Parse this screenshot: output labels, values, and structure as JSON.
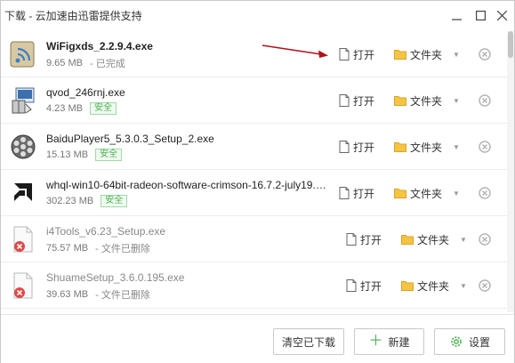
{
  "window": {
    "title": "下载 - 云加速由迅雷提供支持"
  },
  "actions": {
    "open_label": "打开",
    "folder_label": "文件夹"
  },
  "downloads": [
    {
      "name": "WiFigxds_2.2.9.4.exe",
      "size": "9.65 MB",
      "status": "- 已完成",
      "badge": "",
      "icon": "wifi-app-icon"
    },
    {
      "name": "qvod_246rnj.exe",
      "size": "4.23 MB",
      "status": "",
      "badge": "安全",
      "icon": "installer-icon"
    },
    {
      "name": "BaiduPlayer5_5.3.0.3_Setup_2.exe",
      "size": "15.13 MB",
      "status": "",
      "badge": "安全",
      "icon": "film-reel-icon"
    },
    {
      "name": "whql-win10-64bit-radeon-software-crimson-16.7.2-july19.e...",
      "size": "302.23 MB",
      "status": "",
      "badge": "安全",
      "icon": "amd-logo-icon"
    },
    {
      "name": "i4Tools_v6.23_Setup.exe",
      "size": "75.57 MB",
      "status": "- 文件已删除",
      "badge": "",
      "icon": "deleted-file-icon"
    },
    {
      "name": "ShuameSetup_3.6.0.195.exe",
      "size": "39.63 MB",
      "status": "- 文件已删除",
      "badge": "",
      "icon": "deleted-file-icon"
    }
  ],
  "footer": {
    "clear_label": "清空已下载",
    "new_label": "新建",
    "settings_label": "设置"
  },
  "colors": {
    "safe_green": "#4caf50",
    "arrow_red": "#b0121b",
    "folder_yellow": "#f5c443"
  }
}
